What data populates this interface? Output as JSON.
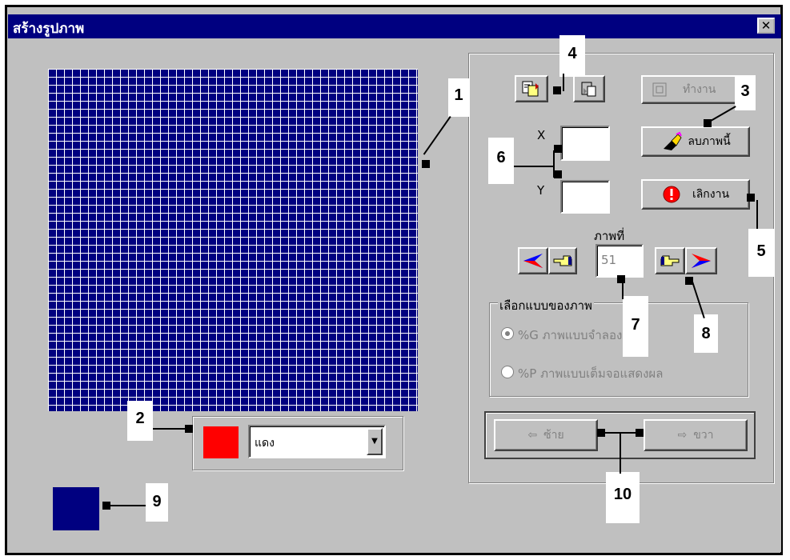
{
  "window": {
    "title": "สร้างรูปภาพ",
    "close_label": "✕"
  },
  "toolbar": {
    "copy_icon": "copy-icon",
    "paste_icon": "paste-icon"
  },
  "buttons": {
    "run_label": "ทำงาน",
    "clear_label": "ลบภาพนี้",
    "cancel_label": "เลิกงาน",
    "left_label": "ซ้าย",
    "right_label": "ขวา"
  },
  "coords": {
    "x_label": "X",
    "y_label": "Y",
    "x_value": "",
    "y_value": ""
  },
  "frame": {
    "label": "ภาพที่",
    "value": "51"
  },
  "format_group": {
    "legend": "เลือกแบบของภาพ",
    "options": [
      {
        "label": "%G ภาพแบบจำลอง",
        "selected": true
      },
      {
        "label": "%P ภาพแบบเต็มจอแสดงผล",
        "selected": false
      }
    ]
  },
  "color": {
    "selected_name": "แดง",
    "swatch": "#ff0000",
    "preview": "#000080"
  },
  "grid": {
    "color": "#000080",
    "line_color": "#ffffff"
  },
  "callouts": [
    "1",
    "2",
    "3",
    "4",
    "5",
    "6",
    "7",
    "8",
    "9",
    "10"
  ]
}
